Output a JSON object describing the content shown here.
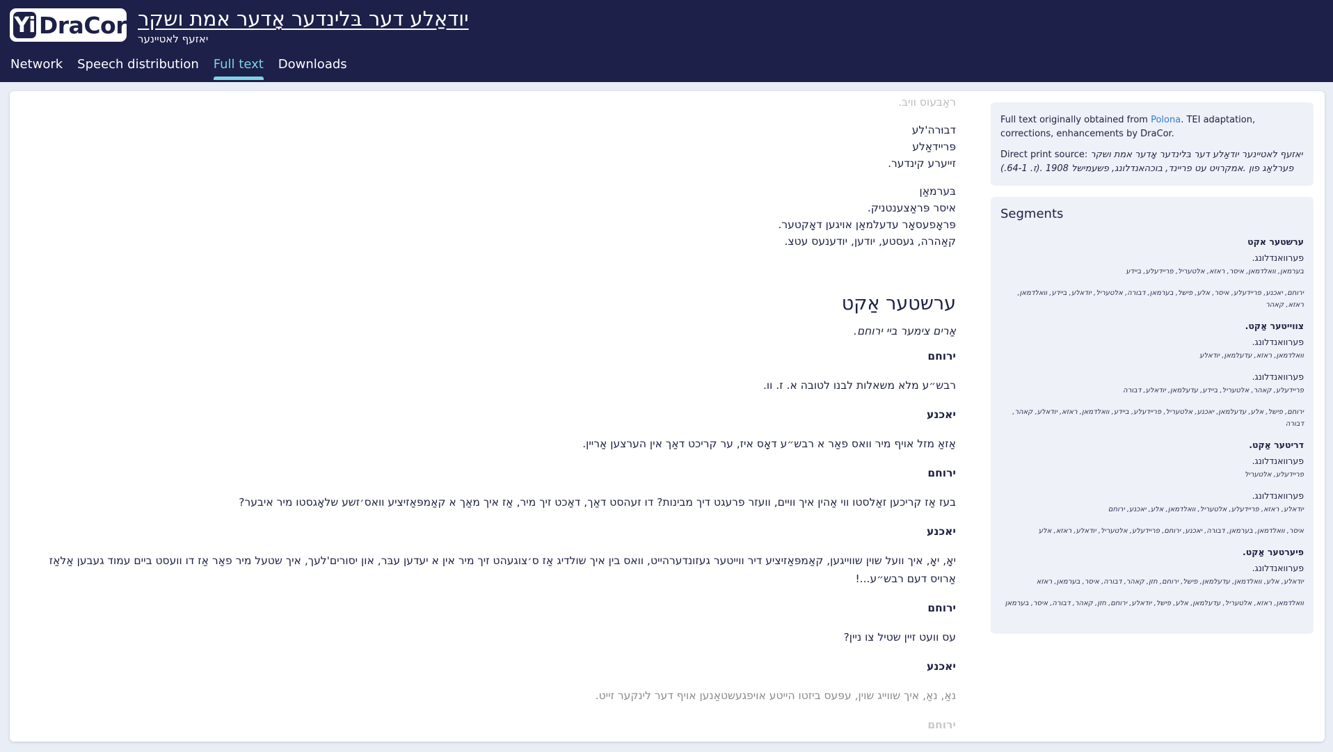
{
  "header": {
    "logo_yi": "Yi",
    "logo_dracor": "DraCor",
    "play_title": "יודאַלע דער בּלינדער אָדער אמת ושקר",
    "play_author": "יאזעף לאטיינער"
  },
  "tabs": [
    {
      "label": "Network"
    },
    {
      "label": "Speech distribution"
    },
    {
      "label": "Full text"
    },
    {
      "label": "Downloads"
    }
  ],
  "cast": {
    "top_faded": "ראַבּעוס וויבּ.",
    "group1": [
      "דבוּרה'לע",
      "פּריידאַלע",
      "זייערע קינדער."
    ],
    "group2": [
      "בּערמאַן",
      "איסר פּראַצענטניק.",
      "פּראָפעסאָר עדעלמאַן אויגען דאָקטער.",
      "קאַהרה, געסטע, יודען, יודענעס עטצ."
    ]
  },
  "act": {
    "heading": "ערשטער אַקט",
    "stage": "אַרים צימער ביי ירוחם."
  },
  "dialogue": [
    {
      "speaker": "ירוחם",
      "text": "רבש״ע מלא משאלות לבנו לטובה א. ז. וו."
    },
    {
      "speaker": "יאכנע",
      "text": "אַזאַ מזל אויף מיר וואס פאַר א רבש״ע דאָס איז, ער קריכט דאַך אין הערצען אַריין."
    },
    {
      "speaker": "ירוחם",
      "text": "בעז אַז קריכען זאַלסטו ווי אַהין איך וויים, וועזר פרעגט דיך מבינות? דו זעהסט דאַך, דאַכט זיך מיר, אַז איך מאַך א קאַמפּאַזיציע וואס׳זשע שלאָגסטו מיר איבער?"
    },
    {
      "speaker": "יאכנע",
      "text": "יאָ, יאָ, איך וועל שוין שווייגען, קאַמפּאַזיציע דיר ווייטער געזונדערהייט, וואס בין איך שולדיג אַז ס׳צוגעהט זיך מיר אין א יעדען עבּר, און יסורים'לעך, איך שטעל מיר פאַר אַז דו וועסט ביים עמוד געבען אַלאַז אַרויס דעם רבש״ע...!"
    },
    {
      "speaker": "ירוחם",
      "text": "עס וועט זיין שטיל צו ניין?"
    },
    {
      "speaker": "יאכנע",
      "text": "נאַ, נאַ, איך שווייג שוין, עפּעס ביזטו הייטע אויפגעשטאַנען אויף דער לינקער זייט."
    }
  ],
  "bottom_faded": "ירוחם",
  "sidebar": {
    "source_prefix": "Full text originally obtained from ",
    "source_link": "Polona",
    "source_suffix": ". TEI adaptation, corrections, enhancements by DraCor.",
    "print_label": "Direct print source: ",
    "print_source": "יאזעף לאטיינער יודאַלע דער בּלינדער אָדער אמת ושקר פערלאַג פון .אמקרויט עט פריינד, בוכהאנדלונג, פשעמישל 1908 .(ז. 64-1.)",
    "segments_title": "Segments",
    "segments": [
      {
        "type": "act",
        "text": "ערשטער אקט"
      },
      {
        "type": "scene",
        "text": "פערוואנדלונג."
      },
      {
        "type": "chars",
        "text": "בערמאן, וואלדמאן, איסר, ראזא, אלטעריל, פריידעלע, ביידע"
      },
      {
        "type": "chars",
        "text": "ירוחם, יאכנע, פריידעלע, איסר, אלע, פישל, בערמאן, דבורה, אלטעריל, יודאלע, ביידע, וואלדמאן, ראזא, קאהר"
      },
      {
        "type": "act",
        "text": "צווייטער אַקט."
      },
      {
        "type": "scene",
        "text": "פערוואנדלונג."
      },
      {
        "type": "chars",
        "text": "וואלדמאן, ראזא, עדעלמאן, יודאלע"
      },
      {
        "type": "scene",
        "text": "פערוואנדלונג."
      },
      {
        "type": "chars",
        "text": "פריידעלע, קאהר, אלטעריל, ביידע, עדעלמאן, יודאלע, דבורה"
      },
      {
        "type": "chars",
        "text": "ירוחם, פישל, אלע, עדעלמאן, יאכנע, אלטעריל, פריידעלע, ביידע, וואלדמאן, ראזא, יודאלע, קאהר, דבורה"
      },
      {
        "type": "act",
        "text": "דריטער אַקט."
      },
      {
        "type": "scene",
        "text": "פערוואנדלונג."
      },
      {
        "type": "chars",
        "text": "פריידעלע, אלטעריל"
      },
      {
        "type": "scene",
        "text": "פערוואנדלונג."
      },
      {
        "type": "chars",
        "text": "יודאלע, ראזא, פריידעלע, אלטעריל, וואלדמאן, אלע, יאכנע, ירוחם"
      },
      {
        "type": "chars",
        "text": "איסר, וואלדמאן, בערמאן, דבורה, יאכנע, ירוחם, פריידעלע, אלטעריל, יודאלע, ראזא, אלע"
      },
      {
        "type": "act",
        "text": "פיערטער אַקט."
      },
      {
        "type": "scene",
        "text": "פערוואנדלונג."
      },
      {
        "type": "chars",
        "text": "יודאלע, אלע, וואלדמאן, עדעלמאן, פישל, ירוחם, חזן, קאהר, דבורה, איסר, בערמאן, ראזא"
      },
      {
        "type": "chars",
        "text": "וואלדמאן, ראזא, אלטעריל, עדעלמאן, אלע, פישל, יודאלע, ירוחם, חזן, קאהר, דבורה, איסר, בערמאן"
      }
    ]
  }
}
